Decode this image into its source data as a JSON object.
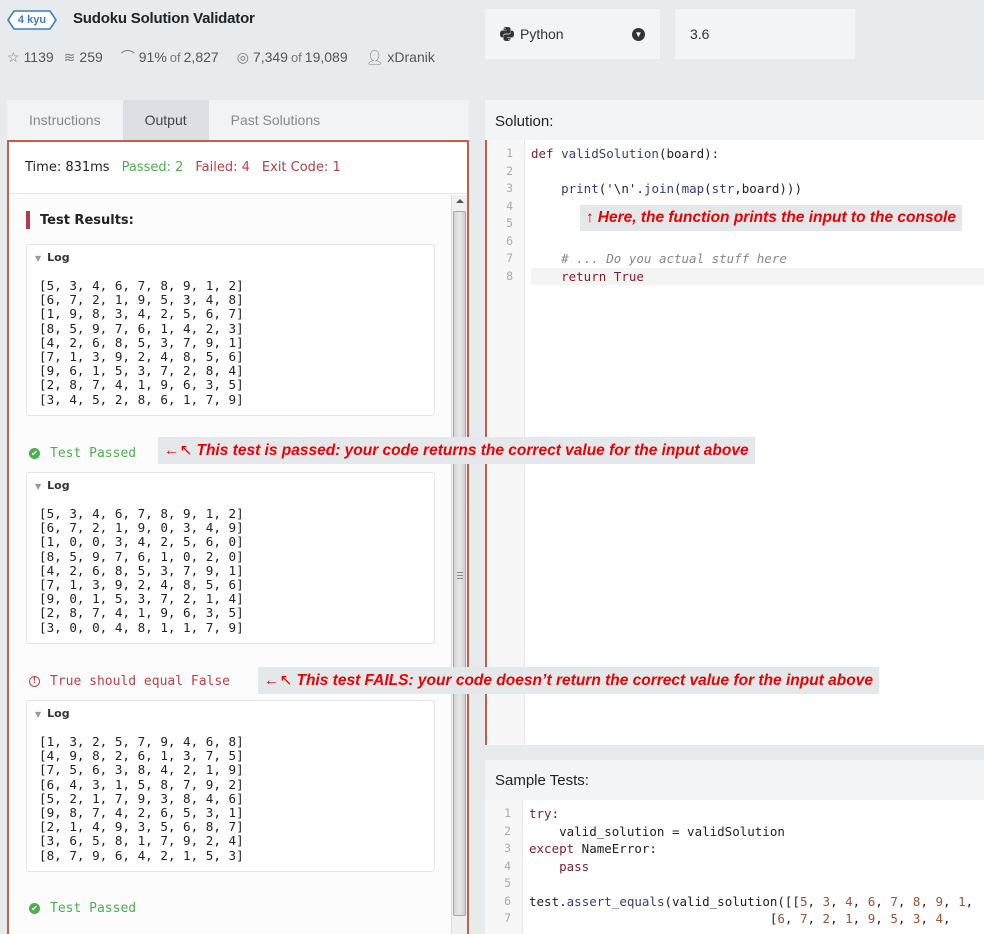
{
  "kata": {
    "rank": "4 kyu",
    "title": "Sudoku Solution Validator",
    "stats": {
      "stars": "1139",
      "collections": "259",
      "satisfaction_pct": "91%",
      "satisfaction_of": "of",
      "satisfaction_total": "2,827",
      "completed": "7,349",
      "completed_of": "of",
      "completed_total": "19,089",
      "author": "xDranik"
    }
  },
  "language": {
    "selected": "Python",
    "version": "3.6"
  },
  "tabs": [
    {
      "label": "Instructions",
      "active": false
    },
    {
      "label": "Output",
      "active": true
    },
    {
      "label": "Past Solutions",
      "active": false
    }
  ],
  "summary": {
    "time": "Time: 831ms",
    "passed": "Passed: 2",
    "failed": "Failed: 4",
    "exit_code": "Exit Code: 1"
  },
  "results": {
    "heading": "Test Results:",
    "log_label": "Log",
    "logs": [
      "[5, 3, 4, 6, 7, 8, 9, 1, 2]\n[6, 7, 2, 1, 9, 5, 3, 4, 8]\n[1, 9, 8, 3, 4, 2, 5, 6, 7]\n[8, 5, 9, 7, 6, 1, 4, 2, 3]\n[4, 2, 6, 8, 5, 3, 7, 9, 1]\n[7, 1, 3, 9, 2, 4, 8, 5, 6]\n[9, 6, 1, 5, 3, 7, 2, 8, 4]\n[2, 8, 7, 4, 1, 9, 6, 3, 5]\n[3, 4, 5, 2, 8, 6, 1, 7, 9]",
      "[5, 3, 4, 6, 7, 8, 9, 1, 2]\n[6, 7, 2, 1, 9, 0, 3, 4, 9]\n[1, 0, 0, 3, 4, 2, 5, 6, 0]\n[8, 5, 9, 7, 6, 1, 0, 2, 0]\n[4, 2, 6, 8, 5, 3, 7, 9, 1]\n[7, 1, 3, 9, 2, 4, 8, 5, 6]\n[9, 0, 1, 5, 3, 7, 2, 1, 4]\n[2, 8, 7, 4, 1, 9, 6, 3, 5]\n[3, 0, 0, 4, 8, 1, 1, 7, 9]",
      "[1, 3, 2, 5, 7, 9, 4, 6, 8]\n[4, 9, 8, 2, 6, 1, 3, 7, 5]\n[7, 5, 6, 3, 8, 4, 2, 1, 9]\n[6, 4, 3, 1, 5, 8, 7, 9, 2]\n[5, 2, 1, 7, 9, 3, 8, 4, 6]\n[9, 8, 7, 4, 2, 6, 5, 3, 1]\n[2, 1, 4, 9, 3, 5, 6, 8, 7]\n[3, 6, 5, 8, 1, 7, 9, 2, 4]\n[8, 7, 9, 6, 4, 2, 1, 5, 3]"
    ],
    "outcomes": [
      {
        "status": "pass",
        "text": "Test Passed"
      },
      {
        "status": "fail",
        "text": "True should equal False"
      },
      {
        "status": "pass",
        "text": "Test Passed"
      }
    ]
  },
  "annotations": {
    "print_note": "Here, the function prints the input to the console",
    "print_arrow": "↑",
    "pass_note": "This test is passed: your code returns the correct value for the input above",
    "fail_note": "This test FAILS:  your code doesn’t return the correct value for the input above",
    "side_arrow": "←↖"
  },
  "solution": {
    "heading": "Solution:",
    "line_numbers": [
      "1",
      "2",
      "3",
      "4",
      "5",
      "6",
      "7",
      "8"
    ]
  },
  "sample_tests": {
    "heading": "Sample Tests:",
    "line_numbers": [
      "1",
      "2",
      "3",
      "4",
      "5",
      "6",
      "7"
    ]
  },
  "colors": {
    "accent_border": "#c0604c",
    "pass": "#4caf50",
    "fail": "#c0404a",
    "annotation": "#e00000"
  }
}
